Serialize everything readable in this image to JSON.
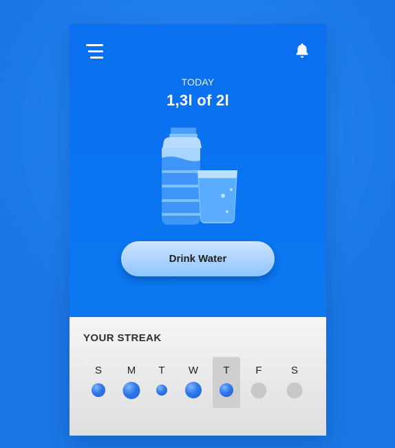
{
  "header": {
    "menu_icon": "menu-icon",
    "bell_icon": "bell-icon"
  },
  "hero": {
    "label": "TODAY",
    "amount": "1,3l of 2l",
    "progress": 0.65
  },
  "action": {
    "drink_label": "Drink Water"
  },
  "streak": {
    "title": "YOUR STREAK",
    "days": [
      {
        "letter": "S",
        "intake": 0.55,
        "done": true,
        "current": false
      },
      {
        "letter": "M",
        "intake": 0.85,
        "done": true,
        "current": false
      },
      {
        "letter": "T",
        "intake": 0.35,
        "done": true,
        "current": false
      },
      {
        "letter": "W",
        "intake": 0.8,
        "done": true,
        "current": false
      },
      {
        "letter": "T",
        "intake": 0.55,
        "done": true,
        "current": true
      },
      {
        "letter": "F",
        "intake": 0.0,
        "done": false,
        "current": false
      },
      {
        "letter": "S",
        "intake": 0.0,
        "done": false,
        "current": false
      }
    ]
  },
  "colors": {
    "background": "#1f7de9",
    "primary": "#0b73ec",
    "dot_filled": "#2f78ea",
    "dot_empty": "#c7c7c7"
  }
}
